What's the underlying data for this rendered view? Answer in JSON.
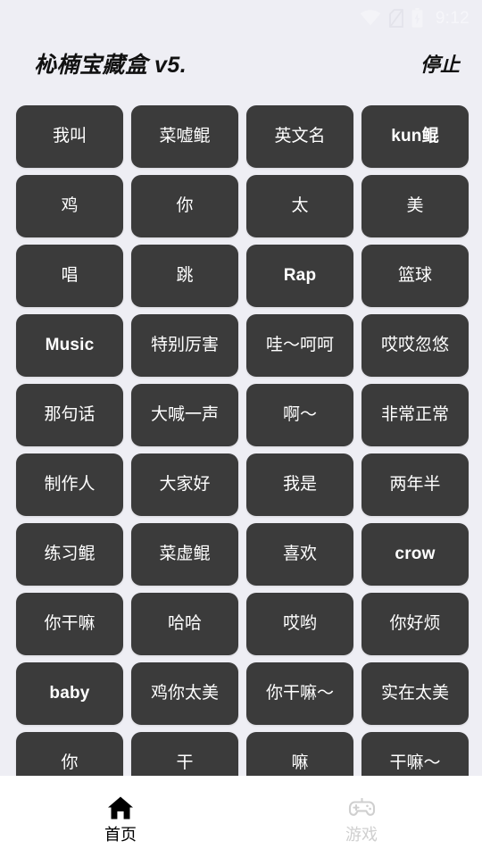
{
  "status_bar": {
    "time": "9:12",
    "icons": [
      "wifi-icon",
      "no-sim-icon",
      "battery-charging-icon"
    ],
    "icon_color": "#f4f4f8",
    "dim_icon_color": "#e3e3ea"
  },
  "header": {
    "title": "杺楠宝藏盒 v5.",
    "stop_label": "停止"
  },
  "theme": {
    "background": "#eeeef4",
    "button_background": "#3b3b3b",
    "button_text": "#ffffff",
    "nav_background": "#ffffff",
    "nav_active": "#000000",
    "nav_inactive": "#cfcfcf"
  },
  "grid": {
    "columns": 4,
    "buttons": [
      {
        "label": "我叫",
        "script": "cjk"
      },
      {
        "label": "菜嘘鲲",
        "script": "cjk"
      },
      {
        "label": "英文名",
        "script": "cjk"
      },
      {
        "label": "kun鲲",
        "script": "latin"
      },
      {
        "label": "鸡",
        "script": "cjk"
      },
      {
        "label": "你",
        "script": "cjk"
      },
      {
        "label": "太",
        "script": "cjk"
      },
      {
        "label": "美",
        "script": "cjk"
      },
      {
        "label": "唱",
        "script": "cjk"
      },
      {
        "label": "跳",
        "script": "cjk"
      },
      {
        "label": "Rap",
        "script": "latin"
      },
      {
        "label": "篮球",
        "script": "cjk"
      },
      {
        "label": "Music",
        "script": "latin"
      },
      {
        "label": "特别厉害",
        "script": "cjk"
      },
      {
        "label": "哇～呵呵",
        "script": "cjk"
      },
      {
        "label": "哎哎忽悠",
        "script": "cjk"
      },
      {
        "label": "那句话",
        "script": "cjk"
      },
      {
        "label": "大喊一声",
        "script": "cjk"
      },
      {
        "label": "啊～",
        "script": "cjk"
      },
      {
        "label": "非常正常",
        "script": "cjk"
      },
      {
        "label": "制作人",
        "script": "cjk"
      },
      {
        "label": "大家好",
        "script": "cjk"
      },
      {
        "label": "我是",
        "script": "cjk"
      },
      {
        "label": "两年半",
        "script": "cjk"
      },
      {
        "label": "练习鲲",
        "script": "cjk"
      },
      {
        "label": "菜虚鲲",
        "script": "cjk"
      },
      {
        "label": "喜欢",
        "script": "cjk"
      },
      {
        "label": "crow",
        "script": "latin"
      },
      {
        "label": "你干嘛",
        "script": "cjk"
      },
      {
        "label": "哈哈",
        "script": "cjk"
      },
      {
        "label": "哎哟",
        "script": "cjk"
      },
      {
        "label": "你好烦",
        "script": "cjk"
      },
      {
        "label": "baby",
        "script": "latin"
      },
      {
        "label": "鸡你太美",
        "script": "cjk"
      },
      {
        "label": "你干嘛～",
        "script": "cjk"
      },
      {
        "label": "实在太美",
        "script": "cjk"
      },
      {
        "label": "你",
        "script": "cjk"
      },
      {
        "label": "干",
        "script": "cjk"
      },
      {
        "label": "嘛",
        "script": "cjk"
      },
      {
        "label": "干嘛～",
        "script": "cjk"
      }
    ]
  },
  "bottom_nav": {
    "items": [
      {
        "label": "首页",
        "icon": "home-icon",
        "active": true
      },
      {
        "label": "游戏",
        "icon": "gamepad-icon",
        "active": false
      }
    ]
  }
}
